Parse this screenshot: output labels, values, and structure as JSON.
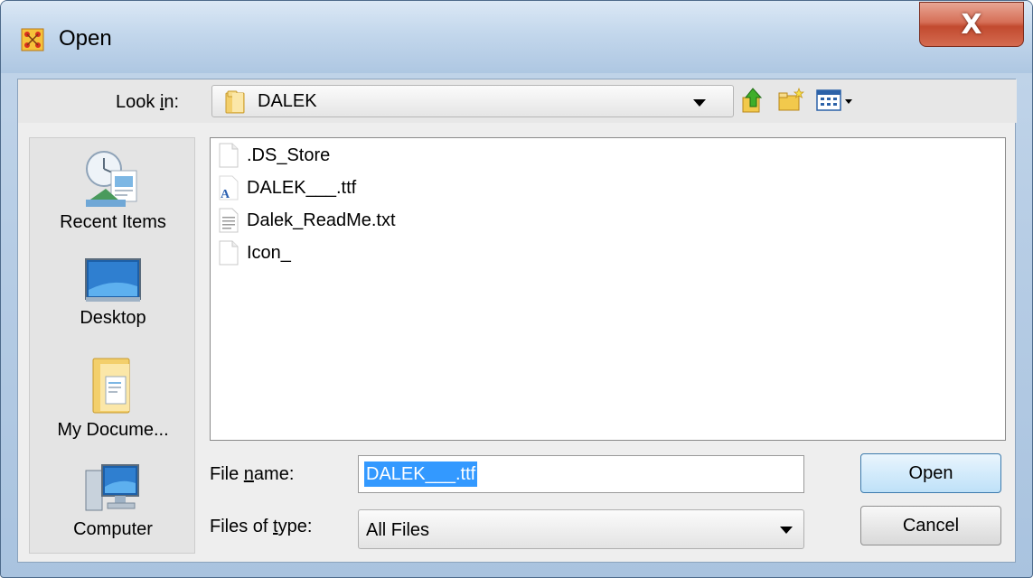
{
  "window": {
    "title": "Open",
    "close_label": "X"
  },
  "lookin": {
    "label_prefix": "Look ",
    "label_mnemonic": "i",
    "label_suffix": "n:",
    "value": "DALEK",
    "toolbar_icons": [
      "up-one-level-icon",
      "create-new-folder-icon",
      "view-menu-icon"
    ]
  },
  "places": [
    {
      "label": "Recent Items",
      "icon": "recent-items-icon"
    },
    {
      "label": "Desktop",
      "icon": "desktop-icon"
    },
    {
      "label": "My Docume...",
      "icon": "my-documents-icon"
    },
    {
      "label": "Computer",
      "icon": "computer-icon"
    }
  ],
  "files": [
    {
      "name": ".DS_Store",
      "icon": "generic-file-icon"
    },
    {
      "name": "DALEK___.ttf",
      "icon": "font-file-icon"
    },
    {
      "name": "Dalek_ReadMe.txt",
      "icon": "text-file-icon"
    },
    {
      "name": "Icon_",
      "icon": "generic-file-icon"
    }
  ],
  "filename": {
    "label_prefix": "File ",
    "label_mnemonic": "n",
    "label_suffix": "ame:",
    "value": "DALEK___.ttf"
  },
  "filetype": {
    "label_prefix": "Files of ",
    "label_mnemonic": "t",
    "label_suffix": "ype:",
    "value": "All Files"
  },
  "buttons": {
    "open": "Open",
    "cancel": "Cancel"
  },
  "colors": {
    "selection": "#3399ff",
    "close_button": "#c24a2f",
    "title_gradient_top": "#dbe8f5"
  }
}
